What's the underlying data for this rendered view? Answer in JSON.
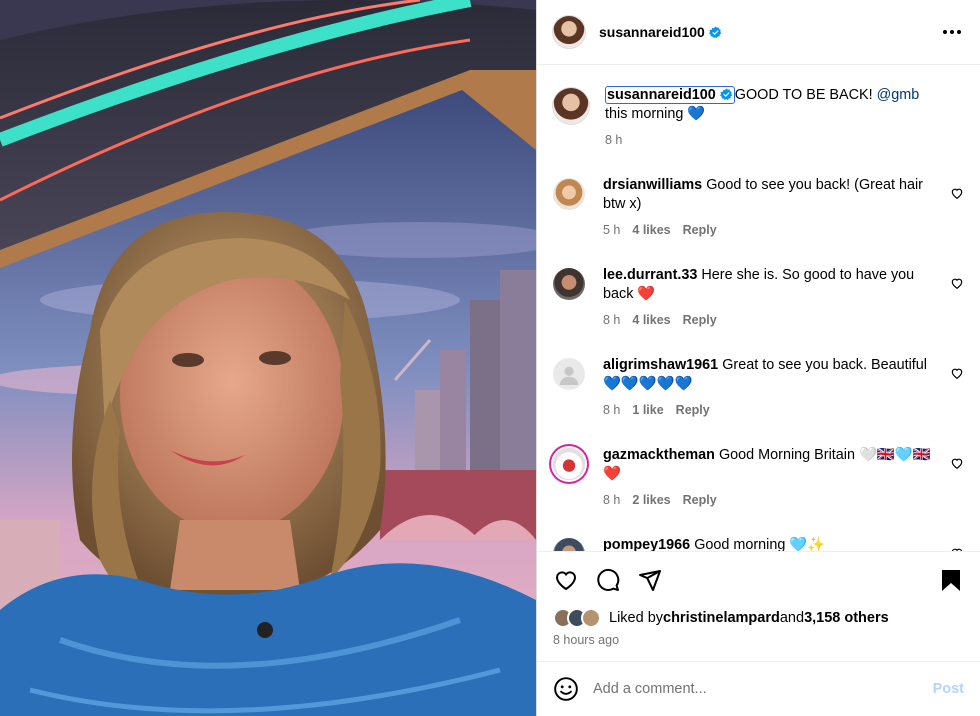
{
  "post": {
    "username": "susannareid100",
    "more_icon": "more-horizontal-icon"
  },
  "caption": {
    "username": "susannareid100",
    "text_before": "GOOD TO BE BACK! ",
    "mention": "@gmb",
    "text_after": " this morning 💙",
    "time": "8 h"
  },
  "comments": [
    {
      "username": "drsianwilliams",
      "text": "Good to see you back! (Great hair btw x)",
      "time": "5 h",
      "likes": "4 likes",
      "reply": "Reply"
    },
    {
      "username": "lee.durrant.33",
      "text": "Here she is. So good to have you back ❤️",
      "time": "8 h",
      "likes": "4 likes",
      "reply": "Reply"
    },
    {
      "username": "aligrimshaw1961",
      "text": "Great to see you back. Beautiful 💙💙💙💙💙",
      "time": "8 h",
      "likes": "1 like",
      "reply": "Reply"
    },
    {
      "username": "gazmacktheman",
      "text": "Good Morning Britain 🤍🇬🇧🩵🇬🇧❤️",
      "time": "8 h",
      "likes": "2 likes",
      "reply": "Reply"
    },
    {
      "username": "pompey1966",
      "text": "Good morning 🩵✨",
      "time": "",
      "likes": "",
      "reply": ""
    }
  ],
  "engagement": {
    "liked_by_prefix": "Liked by ",
    "liked_by_user": "christinelampard",
    "liked_by_mid": " and ",
    "liked_by_others": "3,158 others",
    "time_ago": "8 hours ago"
  },
  "add_comment": {
    "placeholder": "Add a comment...",
    "post_label": "Post"
  },
  "colors": {
    "verified": "#0095f6",
    "link": "#00376b",
    "post_disabled": "#b3d4fc"
  }
}
